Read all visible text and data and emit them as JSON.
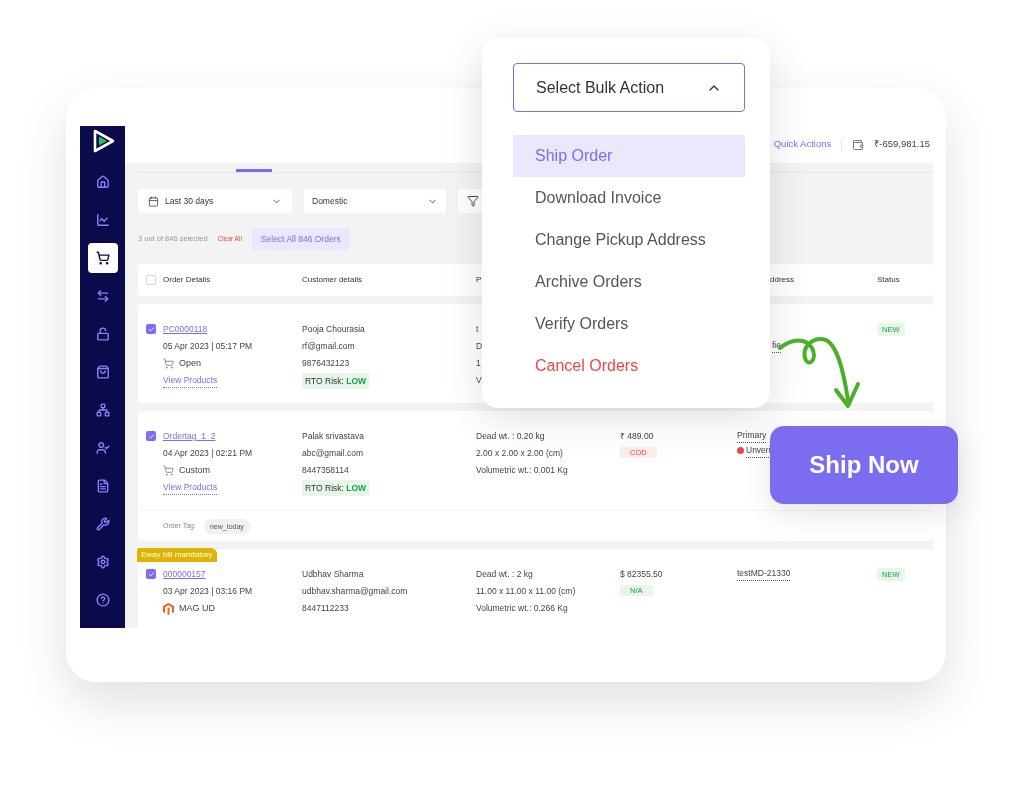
{
  "sidebar": {
    "items": [
      {
        "kind": "home",
        "selected": false
      },
      {
        "kind": "chart",
        "selected": false
      },
      {
        "kind": "cart",
        "selected": true
      },
      {
        "kind": "return",
        "selected": false
      },
      {
        "kind": "lock",
        "selected": false
      },
      {
        "kind": "bag",
        "selected": false
      },
      {
        "kind": "network",
        "selected": false
      },
      {
        "kind": "user",
        "selected": false
      },
      {
        "kind": "document",
        "selected": false
      },
      {
        "kind": "tools",
        "selected": false
      },
      {
        "kind": "settings",
        "selected": false
      },
      {
        "kind": "help",
        "selected": false
      }
    ]
  },
  "header": {
    "quick_actions": "Quick Actions",
    "balance": "₹-659,981.15"
  },
  "filters": {
    "date_range": "Last 30 days",
    "region": "Domestic"
  },
  "selection": {
    "summary": "3 out of 846 selected",
    "clear": "Clear All",
    "select_all": "Select All 846 Orders"
  },
  "table": {
    "header_checked": false,
    "columns": [
      {
        "text": "Order Details",
        "cut": false
      },
      {
        "text": "Customer details",
        "cut": false
      },
      {
        "text": "P",
        "cut": false
      },
      {
        "text": "ddress",
        "cut": true
      },
      {
        "text": "Status",
        "cut": false
      }
    ],
    "rows": [
      {
        "selected": true,
        "order_id": "PC0000118",
        "date": "05 Apr 2023 | 05:17 PM",
        "channel": {
          "text": "Open",
          "kind": "cart"
        },
        "view_products": "View Products",
        "customer": [
          "Pooja Chourasia",
          "rf@gmail.com",
          "9876432123"
        ],
        "rto": {
          "label": "RTO Risk:",
          "level": "LOW"
        },
        "package": [
          "t",
          "D",
          "1",
          "V"
        ],
        "address": [
          {
            "text": "fie",
            "cut": true,
            "warning": false
          }
        ],
        "status": "NEW"
      },
      {
        "selected": true,
        "order_id": "Ordertag_1_2",
        "date": "04 Apr 2023 | 02:21 PM",
        "channel": {
          "text": "Custom",
          "kind": "cart"
        },
        "view_products": "View Products",
        "customer": [
          "Palak srivastava",
          "abc@gmail.com",
          "8447358114"
        ],
        "rto": {
          "label": "RTO Risk:",
          "level": "LOW"
        },
        "package": [
          "Dead wt. : 0.20 kg",
          "2.00 x 2.00 x 2.00 (cm)",
          "Volumetric wt.: 0.001 Kg"
        ],
        "price": "₹ 489.00",
        "payment": {
          "text": "COD",
          "kind": "cod"
        },
        "address": [
          {
            "text": "Primary",
            "cut": false,
            "warning": false
          },
          {
            "text": "Unveri",
            "cut": false,
            "warning": true
          }
        ],
        "order_tag": {
          "label": "Order Tag:",
          "tag": "new_today"
        }
      },
      {
        "selected": true,
        "eway": "Eway bill mandatory",
        "order_id": "000000157",
        "date": "03 Apr 2023 | 03:16 PM",
        "channel": {
          "text": "MAG UD",
          "kind": "magento"
        },
        "customer": [
          "Udbhav Sharma",
          "udbhav.sharma@gmail.com",
          "8447112233"
        ],
        "package": [
          "Dead wt. : 2 kg",
          "11.00 x 11.00 x 11.00 (cm)",
          "Volumetric wt.: 0.266 Kg"
        ],
        "price": "$ 82355.50",
        "payment": {
          "text": "N/A",
          "kind": "prepaid"
        },
        "address": [
          {
            "text": "testMD-21330",
            "cut": false,
            "warning": false
          }
        ],
        "status": "NEW"
      }
    ]
  },
  "bulk_action": {
    "label": "Select Bulk Action",
    "expanded": true,
    "items": [
      {
        "text": "Ship Order",
        "selected": true,
        "kind": "action"
      },
      {
        "text": "Download Invoice",
        "selected": false,
        "kind": "action"
      },
      {
        "text": "Change Pickup Address",
        "selected": false,
        "kind": "action"
      },
      {
        "text": "Archive Orders",
        "selected": false,
        "kind": "action"
      },
      {
        "text": "Verify Orders",
        "selected": false,
        "kind": "action"
      },
      {
        "text": "Cancel Orders",
        "selected": false,
        "kind": "destructive"
      }
    ]
  },
  "ship_now": "Ship Now"
}
